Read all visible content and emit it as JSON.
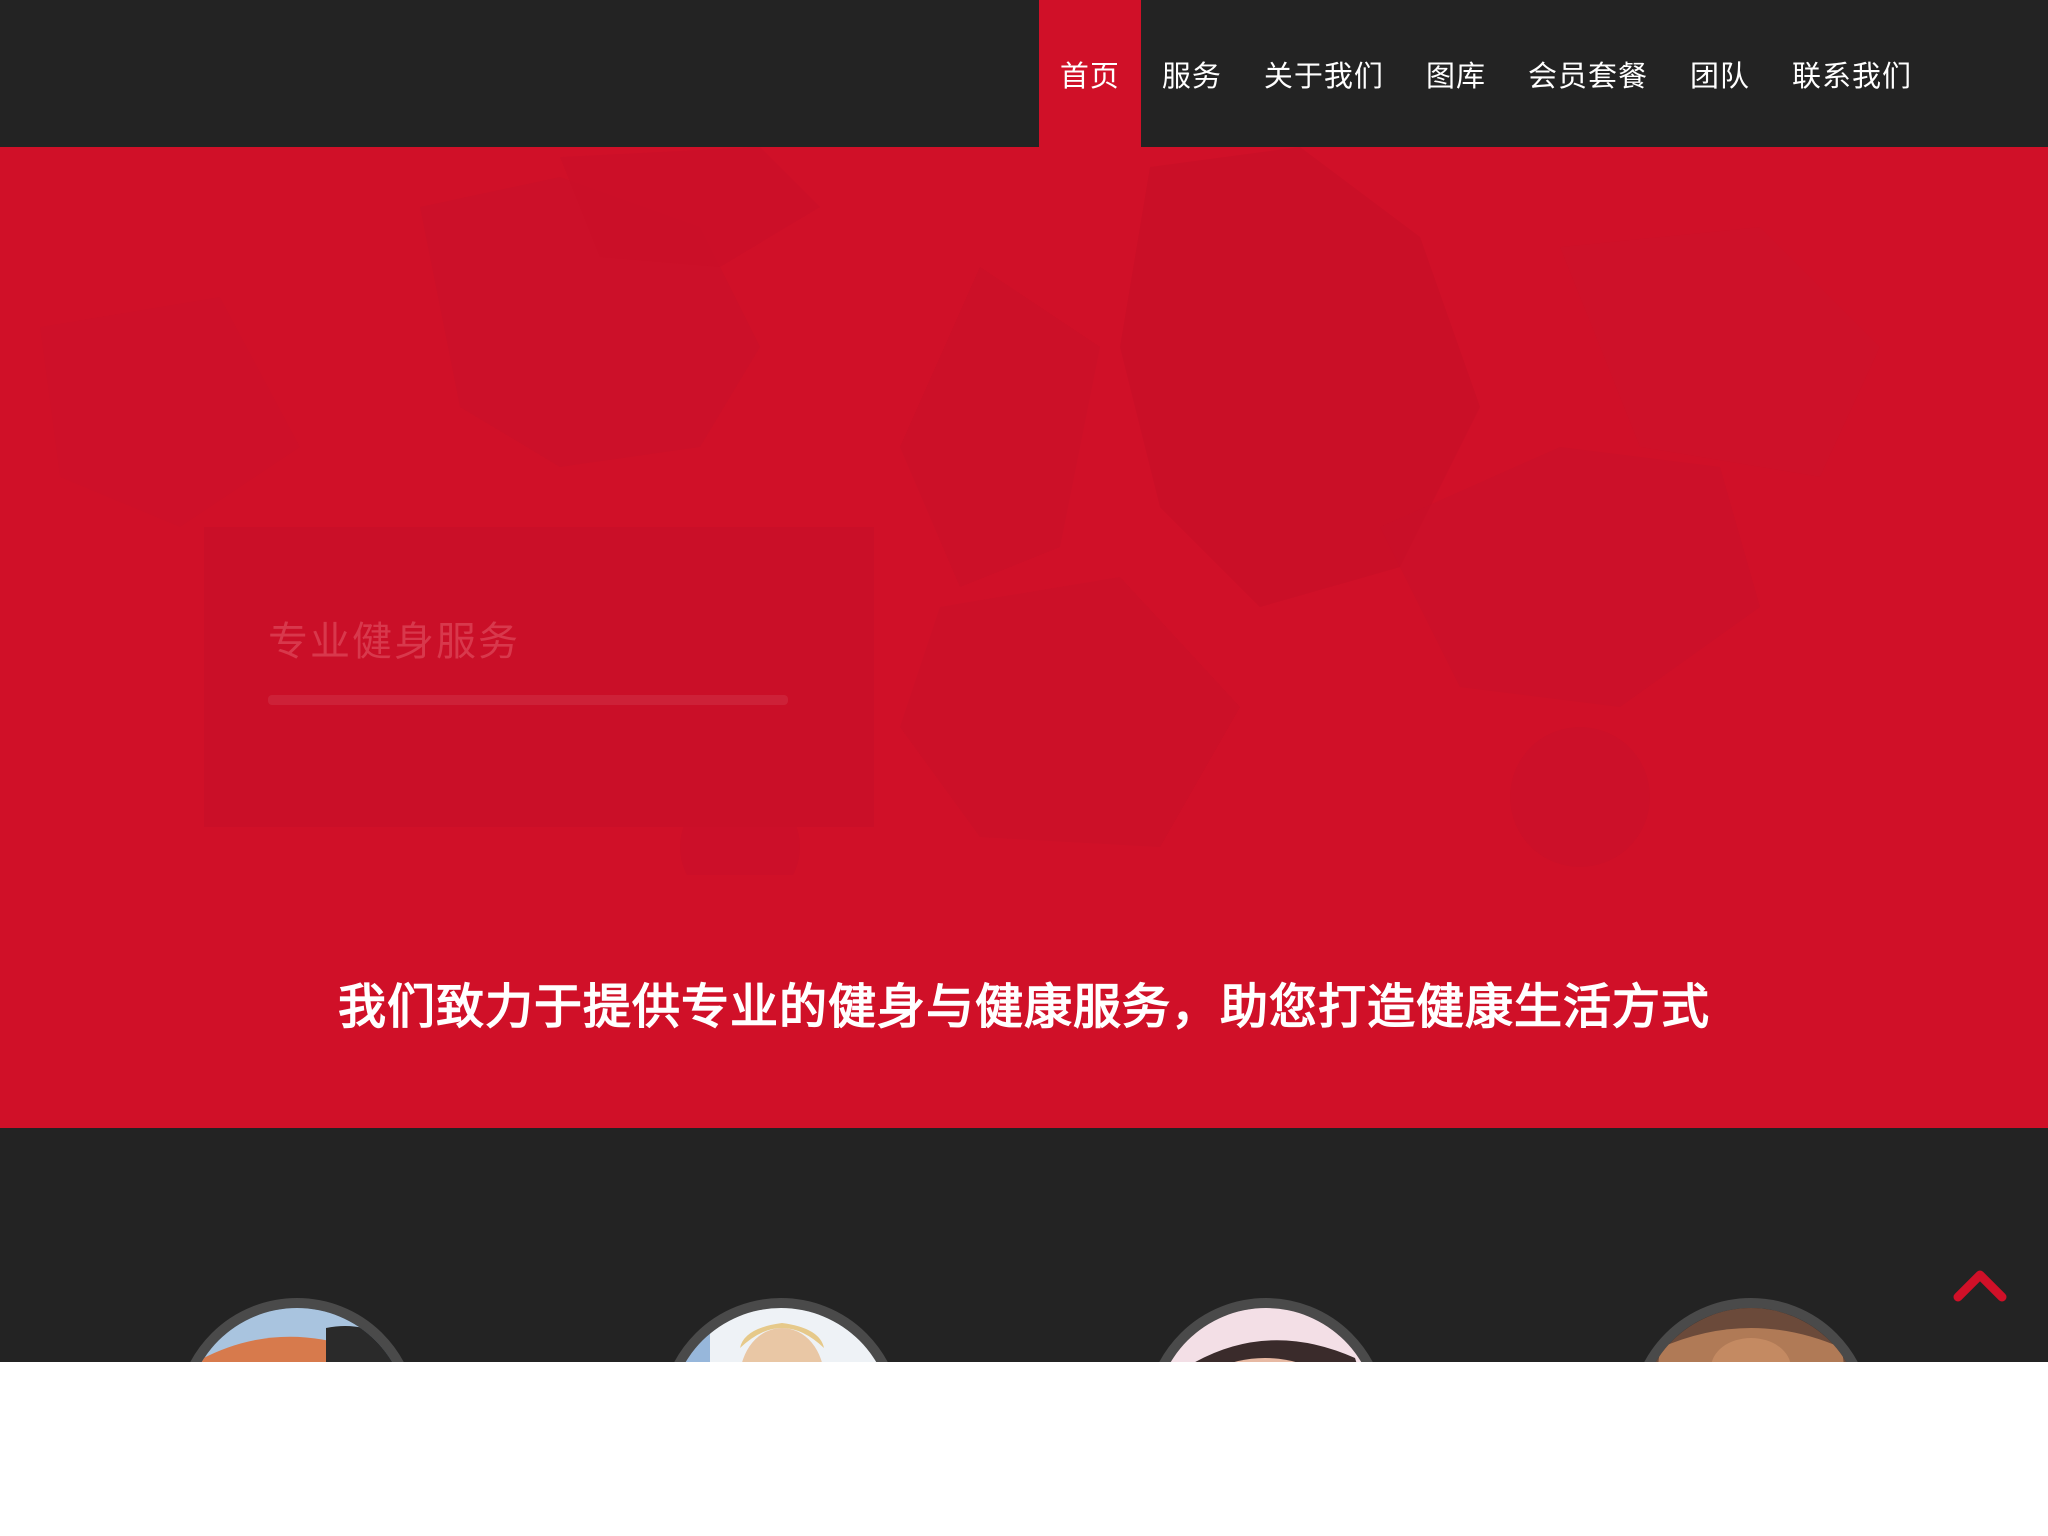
{
  "nav": {
    "items": [
      {
        "label": "首页",
        "active": true
      },
      {
        "label": "服务",
        "active": false
      },
      {
        "label": "关于我们",
        "active": false
      },
      {
        "label": "图库",
        "active": false
      },
      {
        "label": "会员套餐",
        "active": false
      },
      {
        "label": "团队",
        "active": false
      },
      {
        "label": "联系我们",
        "active": false
      }
    ]
  },
  "hero": {
    "slide_title": "专业健身服务"
  },
  "tagline": "我们致力于提供专业的健身与健康服务，助您打造健康生活方式",
  "services": {
    "avatar_icons": [
      "trainer-photo-icon",
      "yoga-photo-icon",
      "massage-photo-icon",
      "bodybuilder-photo-icon"
    ]
  },
  "back_to_top": {
    "icon": "chevron-up-icon"
  },
  "colors": {
    "accent": "#d01028",
    "dark": "#232323",
    "text_light": "#ffffff"
  }
}
